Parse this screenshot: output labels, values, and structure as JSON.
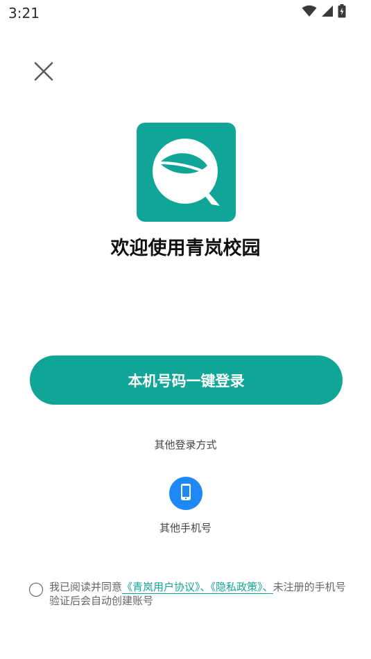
{
  "status_bar": {
    "time": "3:21",
    "icons": [
      "wifi-icon",
      "signal-icon",
      "battery-icon"
    ]
  },
  "colors": {
    "brand": "#10a597",
    "phone_button": "#1e88f5"
  },
  "header": {
    "close_icon": "close-icon"
  },
  "app": {
    "logo_icon": "leaf-q-logo",
    "welcome_title": "欢迎使用青岚校园"
  },
  "login": {
    "one_click_label": "本机号码一键登录",
    "other_methods_label": "其他登录方式",
    "phone_icon": "phone-icon",
    "phone_login_label": "其他手机号"
  },
  "agreement": {
    "prefix": "我已阅读并同意",
    "user_agreement": "《青岚用户协议》",
    "separator1": "、",
    "privacy_policy": "《隐私政策》",
    "separator2": "、",
    "suffix": "未注册的手机号验证后会自动创建账号"
  }
}
